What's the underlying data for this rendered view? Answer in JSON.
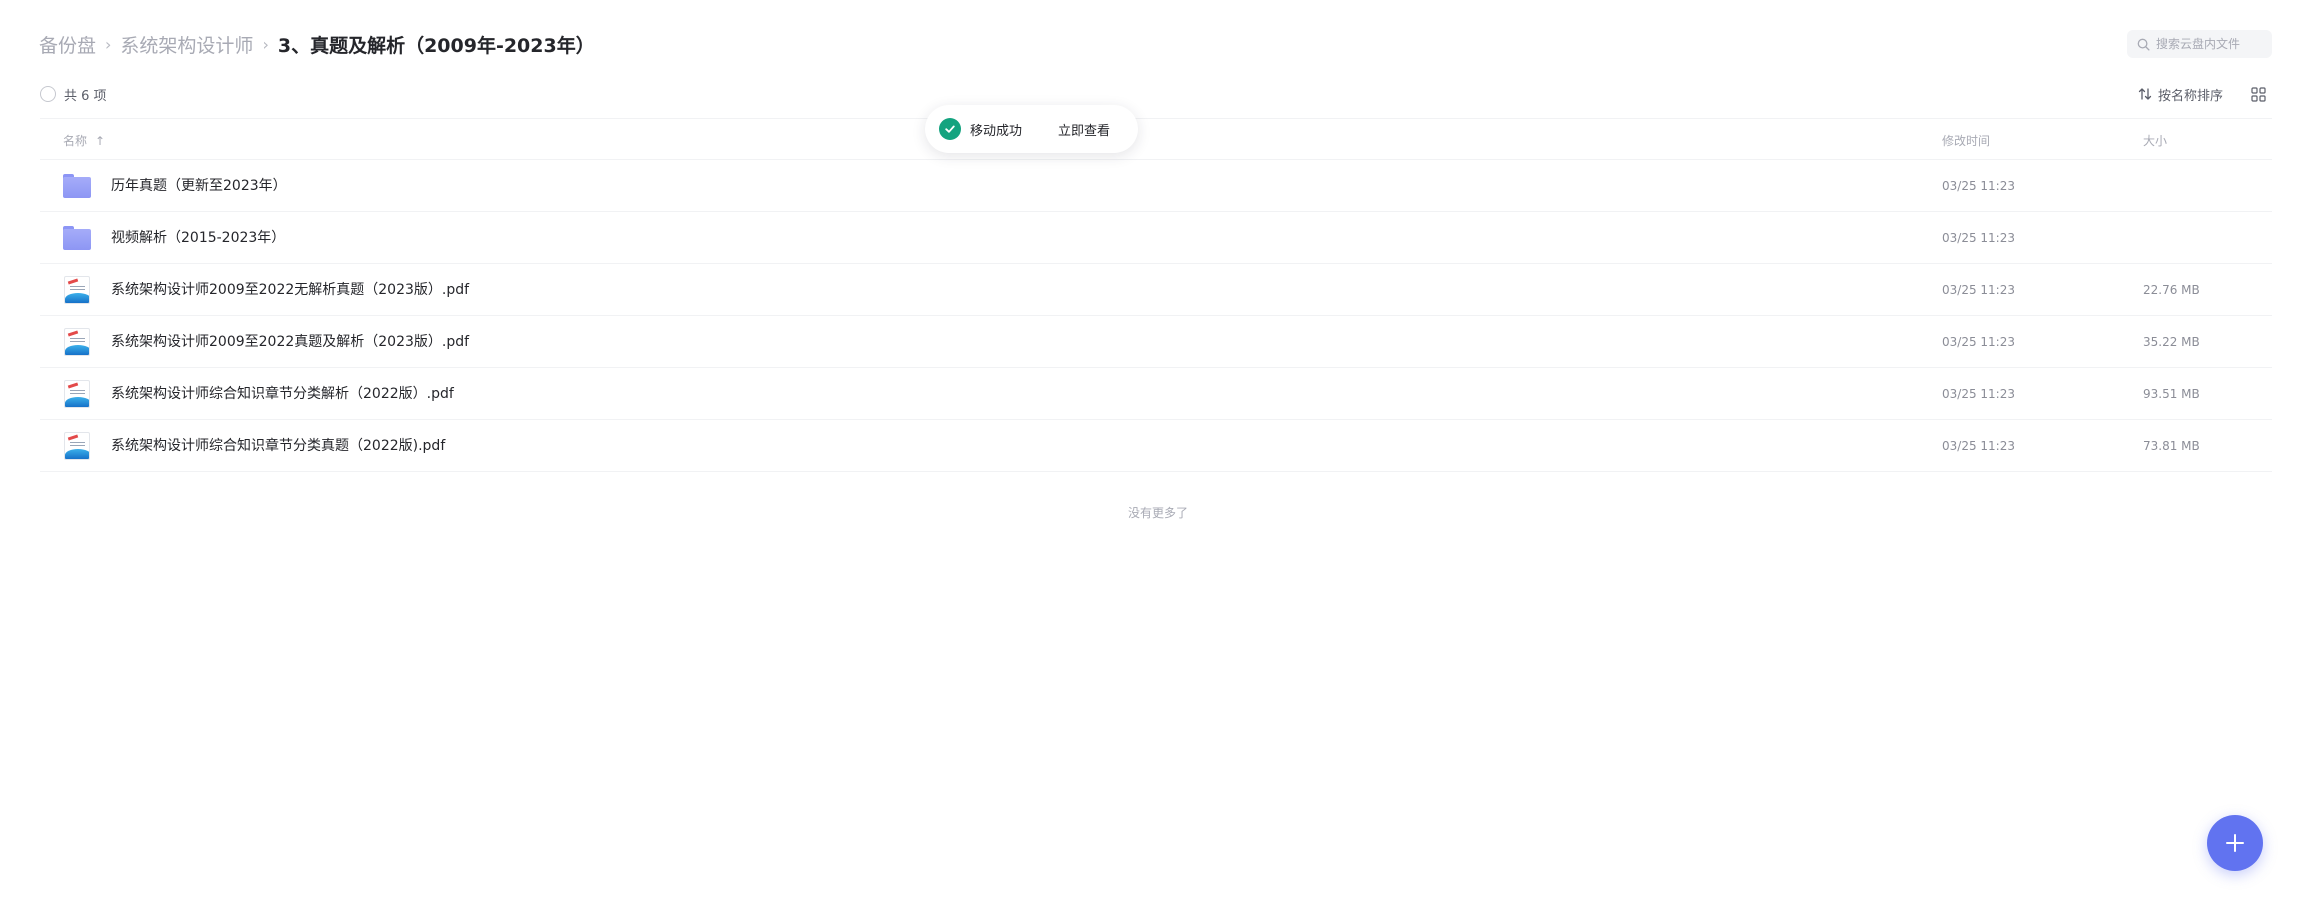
{
  "breadcrumb": {
    "items": [
      "备份盘",
      "系统架构设计师"
    ],
    "current": "3、真题及解析（2009年-2023年）"
  },
  "search": {
    "placeholder": "搜索云盘内文件",
    "icon": "search-icon"
  },
  "toolbar": {
    "count_label": "共 6 项",
    "sort_label": "按名称排序",
    "sort_icon": "sort-arrows-icon",
    "view_icon": "grid-view-icon"
  },
  "table": {
    "headers": {
      "name": "名称",
      "time": "修改时间",
      "size": "大小"
    },
    "rows": [
      {
        "type": "folder",
        "name": "历年真题（更新至2023年）",
        "time": "03/25 11:23",
        "size": ""
      },
      {
        "type": "folder",
        "name": "视频解析（2015-2023年）",
        "time": "03/25 11:23",
        "size": ""
      },
      {
        "type": "pdf",
        "name": "系统架构设计师2009至2022无解析真题（2023版）.pdf",
        "time": "03/25 11:23",
        "size": "22.76 MB"
      },
      {
        "type": "pdf",
        "name": "系统架构设计师2009至2022真题及解析（2023版）.pdf",
        "time": "03/25 11:23",
        "size": "35.22 MB"
      },
      {
        "type": "pdf",
        "name": "系统架构设计师综合知识章节分类解析（2022版）.pdf",
        "time": "03/25 11:23",
        "size": "93.51 MB"
      },
      {
        "type": "pdf",
        "name": "系统架构设计师综合知识章节分类真题（2022版).pdf",
        "time": "03/25 11:23",
        "size": "73.81 MB"
      }
    ],
    "footer": "没有更多了"
  },
  "toast": {
    "message": "移动成功",
    "action": "立即查看"
  },
  "colors": {
    "accent": "#6173f0",
    "success": "#14a37f",
    "folder": "#9ba3f7"
  }
}
